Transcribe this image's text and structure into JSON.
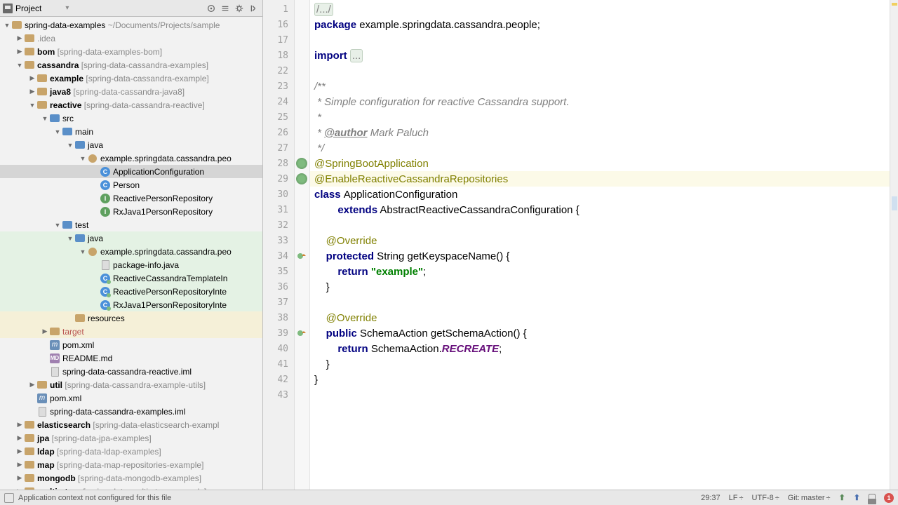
{
  "tool": {
    "title": "Project"
  },
  "tree": [
    {
      "d": 0,
      "t": "▼",
      "i": "folder",
      "label": "spring-data-examples",
      "suffix": " ~/Documents/Projects/sample",
      "selected": false
    },
    {
      "d": 1,
      "t": "▶",
      "i": "folder",
      "label": ".idea",
      "selected": false,
      "gray": true
    },
    {
      "d": 1,
      "t": "▶",
      "i": "folder",
      "label": "bom",
      "bold": true,
      "suffix": " [spring-data-examples-bom]"
    },
    {
      "d": 1,
      "t": "▼",
      "i": "folder",
      "label": "cassandra",
      "bold": true,
      "suffix": " [spring-data-cassandra-examples]"
    },
    {
      "d": 2,
      "t": "▶",
      "i": "folder",
      "label": "example",
      "bold": true,
      "suffix": " [spring-data-cassandra-example]"
    },
    {
      "d": 2,
      "t": "▶",
      "i": "folder",
      "label": "java8",
      "bold": true,
      "suffix": " [spring-data-cassandra-java8]"
    },
    {
      "d": 2,
      "t": "▼",
      "i": "folder",
      "label": "reactive",
      "bold": true,
      "suffix": " [spring-data-cassandra-reactive]"
    },
    {
      "d": 3,
      "t": "▼",
      "i": "folder-blue",
      "label": "src"
    },
    {
      "d": 4,
      "t": "▼",
      "i": "folder-blue",
      "label": "main"
    },
    {
      "d": 5,
      "t": "▼",
      "i": "folder-blue",
      "label": "java"
    },
    {
      "d": 6,
      "t": "▼",
      "i": "pkg",
      "label": "example.springdata.cassandra.peo"
    },
    {
      "d": 7,
      "t": "",
      "i": "class",
      "txt": "C",
      "label": "ApplicationConfiguration",
      "selected": true
    },
    {
      "d": 7,
      "t": "",
      "i": "class",
      "txt": "C",
      "label": "Person"
    },
    {
      "d": 7,
      "t": "",
      "i": "interface",
      "txt": "I",
      "label": "ReactivePersonRepository"
    },
    {
      "d": 7,
      "t": "",
      "i": "interface",
      "txt": "I",
      "label": "RxJava1PersonRepository"
    },
    {
      "d": 4,
      "t": "▼",
      "i": "folder-blue",
      "label": "test"
    },
    {
      "d": 5,
      "t": "▼",
      "i": "folder-blue",
      "label": "java",
      "hl": "green"
    },
    {
      "d": 6,
      "t": "▼",
      "i": "pkg",
      "label": "example.springdata.cassandra.peo",
      "hl": "green"
    },
    {
      "d": 7,
      "t": "",
      "i": "file",
      "label": "package-info.java",
      "hl": "green"
    },
    {
      "d": 7,
      "t": "",
      "i": "class",
      "txt": "C",
      "test": true,
      "label": "ReactiveCassandraTemplateIn",
      "hl": "green"
    },
    {
      "d": 7,
      "t": "",
      "i": "class",
      "txt": "C",
      "test": true,
      "label": "ReactivePersonRepositoryInte",
      "hl": "green"
    },
    {
      "d": 7,
      "t": "",
      "i": "class",
      "txt": "C",
      "test": true,
      "label": "RxJava1PersonRepositoryInte",
      "hl": "green"
    },
    {
      "d": 5,
      "t": "",
      "i": "folder",
      "label": "resources",
      "hl": "yellow"
    },
    {
      "d": 3,
      "t": "▶",
      "i": "folder",
      "label": "target",
      "excluded": true,
      "hl": "yellow"
    },
    {
      "d": 3,
      "t": "",
      "i": "maven",
      "txt": "m",
      "label": "pom.xml"
    },
    {
      "d": 3,
      "t": "",
      "i": "md",
      "txt": "MD",
      "label": "README.md"
    },
    {
      "d": 3,
      "t": "",
      "i": "file",
      "label": "spring-data-cassandra-reactive.iml"
    },
    {
      "d": 2,
      "t": "▶",
      "i": "folder",
      "label": "util",
      "bold": true,
      "suffix": " [spring-data-cassandra-example-utils]"
    },
    {
      "d": 2,
      "t": "",
      "i": "maven",
      "txt": "m",
      "label": "pom.xml"
    },
    {
      "d": 2,
      "t": "",
      "i": "file",
      "label": "spring-data-cassandra-examples.iml"
    },
    {
      "d": 1,
      "t": "▶",
      "i": "folder",
      "label": "elasticsearch",
      "bold": true,
      "suffix": " [spring-data-elasticsearch-exampl"
    },
    {
      "d": 1,
      "t": "▶",
      "i": "folder",
      "label": "jpa",
      "bold": true,
      "suffix": " [spring-data-jpa-examples]"
    },
    {
      "d": 1,
      "t": "▶",
      "i": "folder",
      "label": "ldap",
      "bold": true,
      "suffix": " [spring-data-ldap-examples]"
    },
    {
      "d": 1,
      "t": "▶",
      "i": "folder",
      "label": "map",
      "bold": true,
      "suffix": " [spring-data-map-repositories-example]"
    },
    {
      "d": 1,
      "t": "▶",
      "i": "folder",
      "label": "mongodb",
      "bold": true,
      "suffix": " [spring-data-mongodb-examples]"
    },
    {
      "d": 1,
      "t": "▶",
      "i": "folder",
      "label": "multi-store",
      "bold": true,
      "suffix": " [spring-data-multi-store-example]"
    }
  ],
  "code": {
    "line_numbers": [
      "1",
      "16",
      "17",
      "18",
      "22",
      "23",
      "24",
      "25",
      "26",
      "27",
      "28",
      "29",
      "30",
      "31",
      "32",
      "33",
      "34",
      "35",
      "36",
      "37",
      "38",
      "39",
      "40",
      "41",
      "42",
      "43"
    ],
    "lines": [
      [
        {
          "c": "fold",
          "t": "/.../"
        }
      ],
      [
        {
          "c": "kw",
          "t": "package"
        },
        {
          "t": " example.springdata.cassandra.people;"
        }
      ],
      [],
      [
        {
          "c": "kw",
          "t": "import"
        },
        {
          "t": " "
        },
        {
          "c": "fold",
          "t": "..."
        }
      ],
      [],
      [
        {
          "c": "com",
          "t": "/**"
        }
      ],
      [
        {
          "c": "com",
          "t": " * Simple configuration for reactive Cassandra support."
        }
      ],
      [
        {
          "c": "com",
          "t": " *"
        }
      ],
      [
        {
          "c": "com",
          "t": " * "
        },
        {
          "c": "com-tag",
          "t": "@author"
        },
        {
          "c": "com",
          "t": " Mark Paluch"
        }
      ],
      [
        {
          "c": "com",
          "t": " */"
        }
      ],
      [
        {
          "c": "ann",
          "t": "@SpringBootApplication"
        }
      ],
      [
        {
          "c": "ann",
          "t": "@EnableReactiveCassandraRepositories"
        }
      ],
      [
        {
          "c": "kw",
          "t": "class"
        },
        {
          "t": " "
        },
        {
          "c": "cls-name",
          "t": "ApplicationConfiguration"
        }
      ],
      [
        {
          "t": "        "
        },
        {
          "c": "kw",
          "t": "extends"
        },
        {
          "t": " AbstractReactiveCassandraConfiguration {"
        }
      ],
      [],
      [
        {
          "t": "    "
        },
        {
          "c": "ann",
          "t": "@Override"
        }
      ],
      [
        {
          "t": "    "
        },
        {
          "c": "kw",
          "t": "protected"
        },
        {
          "t": " String getKeyspaceName() {"
        }
      ],
      [
        {
          "t": "        "
        },
        {
          "c": "kw",
          "t": "return"
        },
        {
          "t": " "
        },
        {
          "c": "str",
          "t": "\"example\""
        },
        {
          "t": ";"
        }
      ],
      [
        {
          "t": "    }"
        }
      ],
      [],
      [
        {
          "t": "    "
        },
        {
          "c": "ann",
          "t": "@Override"
        }
      ],
      [
        {
          "t": "    "
        },
        {
          "c": "kw",
          "t": "public"
        },
        {
          "t": " SchemaAction getSchemaAction() {"
        }
      ],
      [
        {
          "t": "        "
        },
        {
          "c": "kw",
          "t": "return"
        },
        {
          "t": " SchemaAction."
        },
        {
          "c": "const",
          "t": "RECREATE"
        },
        {
          "t": ";"
        }
      ],
      [
        {
          "t": "    }"
        }
      ],
      [
        {
          "t": "}"
        }
      ],
      []
    ],
    "markers": {
      "10": "spring",
      "11": "spring",
      "16": "override",
      "21": "override"
    }
  },
  "status": {
    "message": "Application context not configured for this file",
    "pos": "29:37",
    "line_sep": "LF",
    "encoding": "UTF-8",
    "git_label": "Git:",
    "git_branch": "master",
    "badge": "1"
  }
}
